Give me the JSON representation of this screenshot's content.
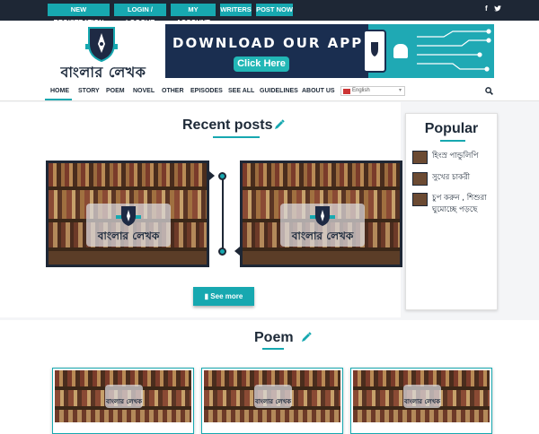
{
  "topbar": {
    "buttons": [
      "NEW REGISTRATION",
      "LOGIN / LOGOUT",
      "MY ACCOUNT",
      "WRITERS",
      "POST NOW"
    ],
    "social": [
      "f",
      "🐦"
    ]
  },
  "logo": {
    "text": "বাংলার লেখক",
    "overlay_small": "বাংলার লেখক"
  },
  "banner": {
    "title": "DOWNLOAD OUR APP!",
    "button": "Click Here",
    "colors": {
      "navy": "#1a2e50",
      "teal": "#1fa9b4"
    }
  },
  "nav": {
    "items": [
      "HOME",
      "STORY",
      "POEM",
      "NOVEL",
      "OTHER",
      "EPISODES",
      "SEE ALL",
      "GUIDELINES",
      "ABOUT US"
    ],
    "active": "HOME",
    "language": "English"
  },
  "recent": {
    "title": "Recent posts",
    "see_more": "See more"
  },
  "popular": {
    "title": "Popular",
    "items": [
      "হিংস্র পান্ডুলিপি",
      "সুখের চাকরী",
      "চুপ করুন , শিশুরা ঘুমোচ্ছে পড়ছে"
    ]
  },
  "poem": {
    "title": "Poem"
  },
  "icons": [
    "pencil-icon",
    "search-icon",
    "book-icon",
    "facebook-icon",
    "twitter-icon",
    "shield-logo-icon",
    "android-icon",
    "phone-icon"
  ],
  "colors": {
    "accent": "#17a8b0",
    "dark": "#1e2735"
  }
}
